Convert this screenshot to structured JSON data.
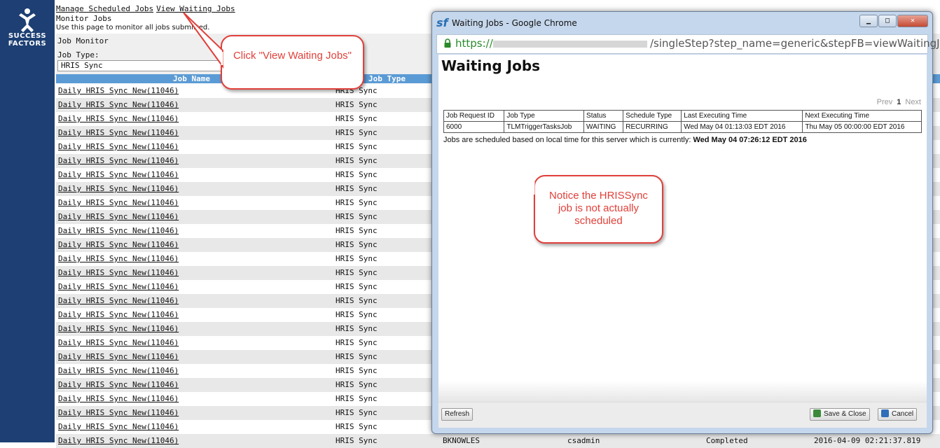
{
  "logo": {
    "line1": "SUCCESS",
    "line2": "FACTORS"
  },
  "nav": {
    "manage_link": "Manage Scheduled Jobs",
    "waiting_link": "View Waiting Jobs"
  },
  "page": {
    "subtitle": "Monitor Jobs",
    "description": "Use this page to monitor all jobs submitted."
  },
  "filter": {
    "section_title": "Job Monitor",
    "job_type_label": "Job Type:",
    "job_type_value": "HRIS Sync"
  },
  "table": {
    "headers": {
      "job_name": "Job Name",
      "job_type": "Job Type"
    },
    "row_job_name": "Daily HRIS Sync New(11046)",
    "row_job_type": "HRIS Sync",
    "last_row": {
      "submitter": "BKNOWLES",
      "owner": "csadmin",
      "status": "Completed",
      "time": "2016-04-09 02:21:37.819"
    }
  },
  "callouts": {
    "click_waiting": "Click \"View Waiting Jobs\"",
    "notice": "Notice the HRISSync job is not actually scheduled"
  },
  "popup": {
    "window_title": "Waiting Jobs - Google Chrome",
    "url_prefix": "https://",
    "url_suffix": "/singleStep?step_name=generic&stepFB=viewWaitingJo",
    "heading": "Waiting Jobs",
    "pager": {
      "prev": "Prev",
      "page": "1",
      "next": "Next"
    },
    "columns": [
      "Job Request ID",
      "Job Type",
      "Status",
      "Schedule Type",
      "Last Executing Time",
      "Next Executing Time"
    ],
    "rows": [
      [
        "6000",
        "TLMTriggerTasksJob",
        "WAITING",
        "RECURRING",
        "Wed May 04 01:13:03 EDT 2016",
        "Thu May 05 00:00:00 EDT 2016"
      ]
    ],
    "note_text": "Jobs are scheduled based on local time for this server which is currently:",
    "note_time": "Wed May 04 07:26:12 EDT 2016",
    "refresh_label": "Refresh",
    "save_close_label": "Save & Close",
    "cancel_label": "Cancel"
  },
  "colors": {
    "sidebar": "#1d3f73",
    "header": "#5b9bd5",
    "callout": "#e0403a"
  }
}
